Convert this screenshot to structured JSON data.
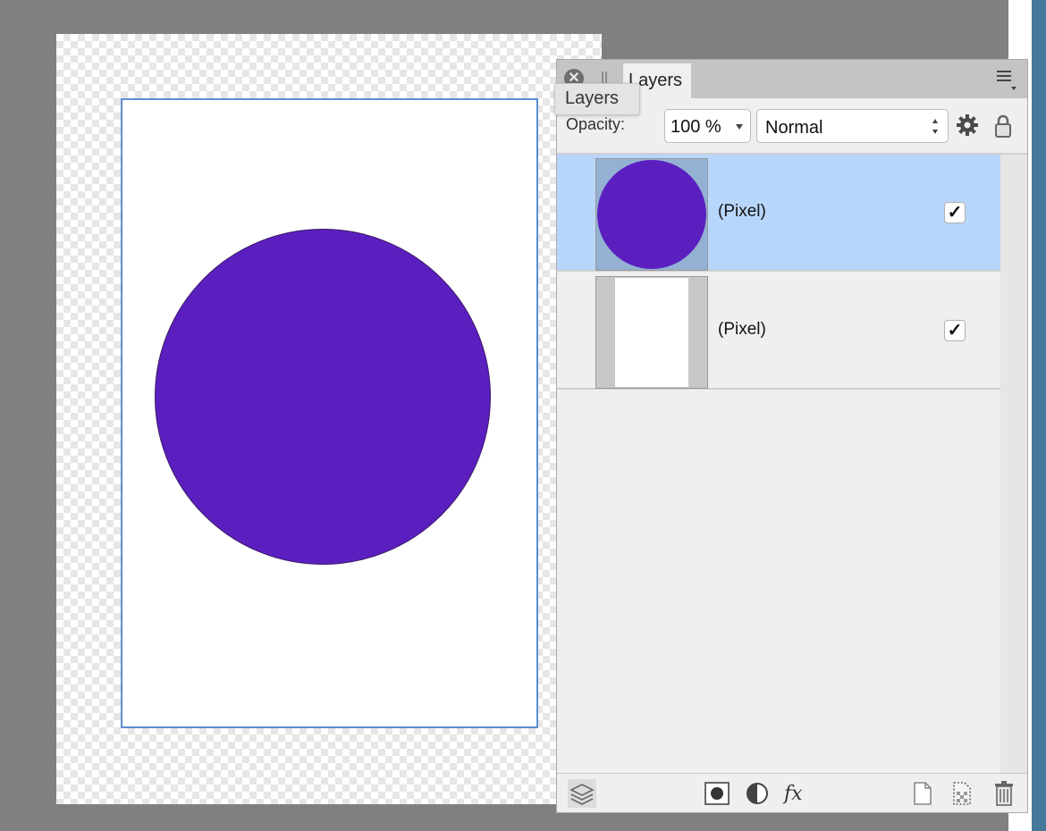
{
  "panel": {
    "tab_label": "Layers",
    "tooltip": "Layers",
    "close_glyph": "✕",
    "opacity_label": "Opacity:",
    "opacity_value": "100 %",
    "blend_mode": "Normal"
  },
  "layers": [
    {
      "name": "(Pixel)",
      "visible_glyph": "✓",
      "selected": true,
      "thumb": "circle"
    },
    {
      "name": "(Pixel)",
      "visible_glyph": "✓",
      "selected": false,
      "thumb": "page"
    }
  ],
  "colors": {
    "circle_fill": "#5b1fbf",
    "selection": "#b8d6fa",
    "document_border": "#5b8fcf"
  },
  "icons": [
    "close-icon",
    "grip-icon",
    "panel-menu-icon",
    "gear-icon",
    "lock-icon",
    "layers-stack-icon",
    "mask-icon",
    "adjustment-icon",
    "fx-icon",
    "new-layer-icon",
    "new-pixel-layer-icon",
    "trash-icon"
  ]
}
